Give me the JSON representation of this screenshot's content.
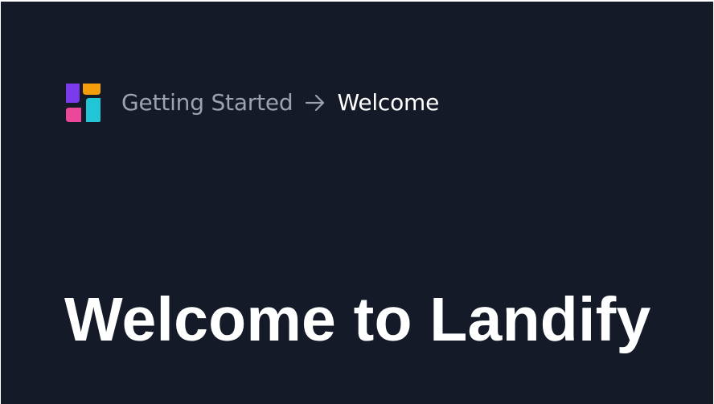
{
  "breadcrumb": {
    "logo_icon": "landify-logo-icon",
    "parent_label": "Getting Started",
    "separator_icon": "arrow-right-icon",
    "current_label": "Welcome"
  },
  "hero": {
    "title": "Welcome to Landify"
  },
  "colors": {
    "background": "#141a28",
    "text_primary": "#ffffff",
    "text_muted": "#9ca3af",
    "logo_purple": "#7c3aed",
    "logo_orange": "#f59e0b",
    "logo_pink": "#ec4899",
    "logo_cyan": "#22c5d6"
  }
}
